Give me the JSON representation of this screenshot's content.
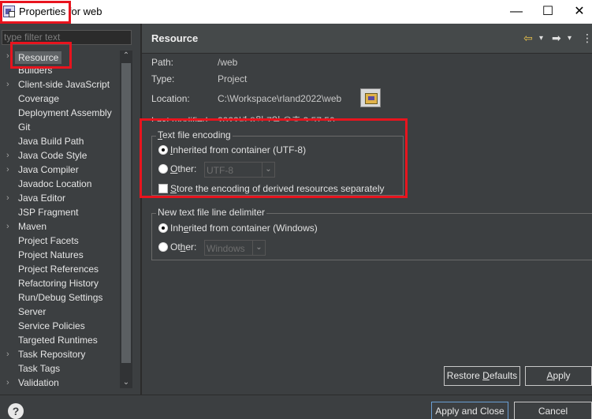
{
  "window": {
    "title": "Properties for web",
    "minimize": "—",
    "maximize": "☐",
    "close": "✕"
  },
  "filter": {
    "placeholder": "type filter text"
  },
  "tree": {
    "items": [
      {
        "label": "Resource",
        "arrow": "›",
        "selected": true
      },
      {
        "label": "Builders",
        "arrow": ""
      },
      {
        "label": "Client-side JavaScript",
        "arrow": "›"
      },
      {
        "label": "Coverage",
        "arrow": ""
      },
      {
        "label": "Deployment Assembly",
        "arrow": ""
      },
      {
        "label": "Git",
        "arrow": ""
      },
      {
        "label": "Java Build Path",
        "arrow": ""
      },
      {
        "label": "Java Code Style",
        "arrow": "›"
      },
      {
        "label": "Java Compiler",
        "arrow": "›"
      },
      {
        "label": "Javadoc Location",
        "arrow": ""
      },
      {
        "label": "Java Editor",
        "arrow": "›"
      },
      {
        "label": "JSP Fragment",
        "arrow": ""
      },
      {
        "label": "Maven",
        "arrow": "›"
      },
      {
        "label": "Project Facets",
        "arrow": ""
      },
      {
        "label": "Project Natures",
        "arrow": ""
      },
      {
        "label": "Project References",
        "arrow": ""
      },
      {
        "label": "Refactoring History",
        "arrow": ""
      },
      {
        "label": "Run/Debug Settings",
        "arrow": ""
      },
      {
        "label": "Server",
        "arrow": ""
      },
      {
        "label": "Service Policies",
        "arrow": ""
      },
      {
        "label": "Targeted Runtimes",
        "arrow": ""
      },
      {
        "label": "Task Repository",
        "arrow": "›"
      },
      {
        "label": "Task Tags",
        "arrow": ""
      },
      {
        "label": "Validation",
        "arrow": "›"
      }
    ],
    "scroll_up": "⌃",
    "scroll_down": "⌄"
  },
  "header": {
    "title": "Resource",
    "back": "⇦",
    "back_menu": "▾",
    "forward": "➡",
    "forward_menu": "▾",
    "menu": "⋮"
  },
  "properties": {
    "path_label": "Path:",
    "path_value": "/web",
    "type_label": "Type:",
    "type_value": "Project",
    "location_label": "Location:",
    "location_value": "C:\\Workspace\\rland2022\\web",
    "modified_label": "Last modified:",
    "modified_value": "2022년 8월 7일 오후 3:57:50"
  },
  "encoding": {
    "title_prefix": "",
    "title_mnemonic": "T",
    "title_rest": "ext file encoding",
    "inherited_m": "I",
    "inherited_rest": "nherited from container (UTF-8)",
    "other_m": "O",
    "other_rest": "ther:",
    "other_value": "UTF-8",
    "derived_m": "S",
    "derived_rest": "tore the encoding of derived resources separately"
  },
  "delimiter": {
    "title": "New text file line delimiter",
    "inherited_pre": "Inh",
    "inherited_m": "e",
    "inherited_rest": "rited from container (Windows)",
    "other_pre": "Ot",
    "other_m": "h",
    "other_rest": "er:",
    "other_value": "Windows"
  },
  "buttons": {
    "restore_pre": "Restore ",
    "restore_m": "D",
    "restore_rest": "efaults",
    "apply_m": "A",
    "apply_rest": "pply",
    "apply_close": "Apply and Close",
    "cancel": "Cancel"
  },
  "help": {
    "glyph": "?"
  },
  "colors": {
    "background": "#3c3f41",
    "highlight_box": "#e8141e",
    "selected_item": "#5f6366"
  }
}
